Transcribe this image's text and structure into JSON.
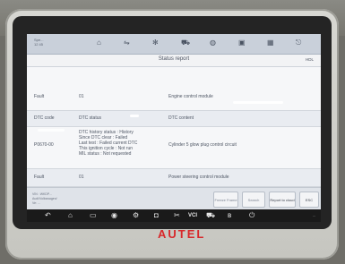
{
  "topbar": {
    "label": "Spe...\n12 45",
    "icons": [
      "home-icon",
      "vehicle-swap-icon",
      "settings-icon",
      "car-icon",
      "globe-icon",
      "print-icon",
      "help-icon",
      "exit-icon"
    ]
  },
  "report": {
    "title": "Status report",
    "zoom": "HDL"
  },
  "rows": [
    {
      "c1": "Fault",
      "c2": "01",
      "c3": "Engine control module"
    },
    {
      "c1": "DTC code",
      "c2": "DTC status",
      "c3": "DTC content"
    },
    {
      "c1": "P0670-00",
      "c2": "DTC history status : History\nSince DTC clear : Failed\nLast test : Failed current DTC\nThis ignition cycle : Not run\nMIL status : Not requested",
      "c3": "Cylinder 5 glow plug control circuit"
    },
    {
      "c1": "Fault",
      "c2": "01",
      "c3": "Power steering control module"
    }
  ],
  "bottombar": {
    "vehicle_lines": [
      "VIN : WKDP...",
      "Audi/Volkswagen/",
      "Ve: ..."
    ],
    "buttons": {
      "freeze": "Freeze Frame",
      "search": "Search",
      "report": "Report to cloud",
      "esc": "ESC"
    }
  },
  "navbar": {
    "icons": [
      "back-icon",
      "home-icon",
      "recent-apps-icon",
      "browser-icon",
      "settings-icon",
      "camera-icon",
      "screenshot-icon",
      "bluetooth-icon"
    ],
    "vci": "VCI",
    "clock": "..."
  },
  "brand": {
    "logo": "AUTEL",
    "logo_color": "#d8282b"
  }
}
